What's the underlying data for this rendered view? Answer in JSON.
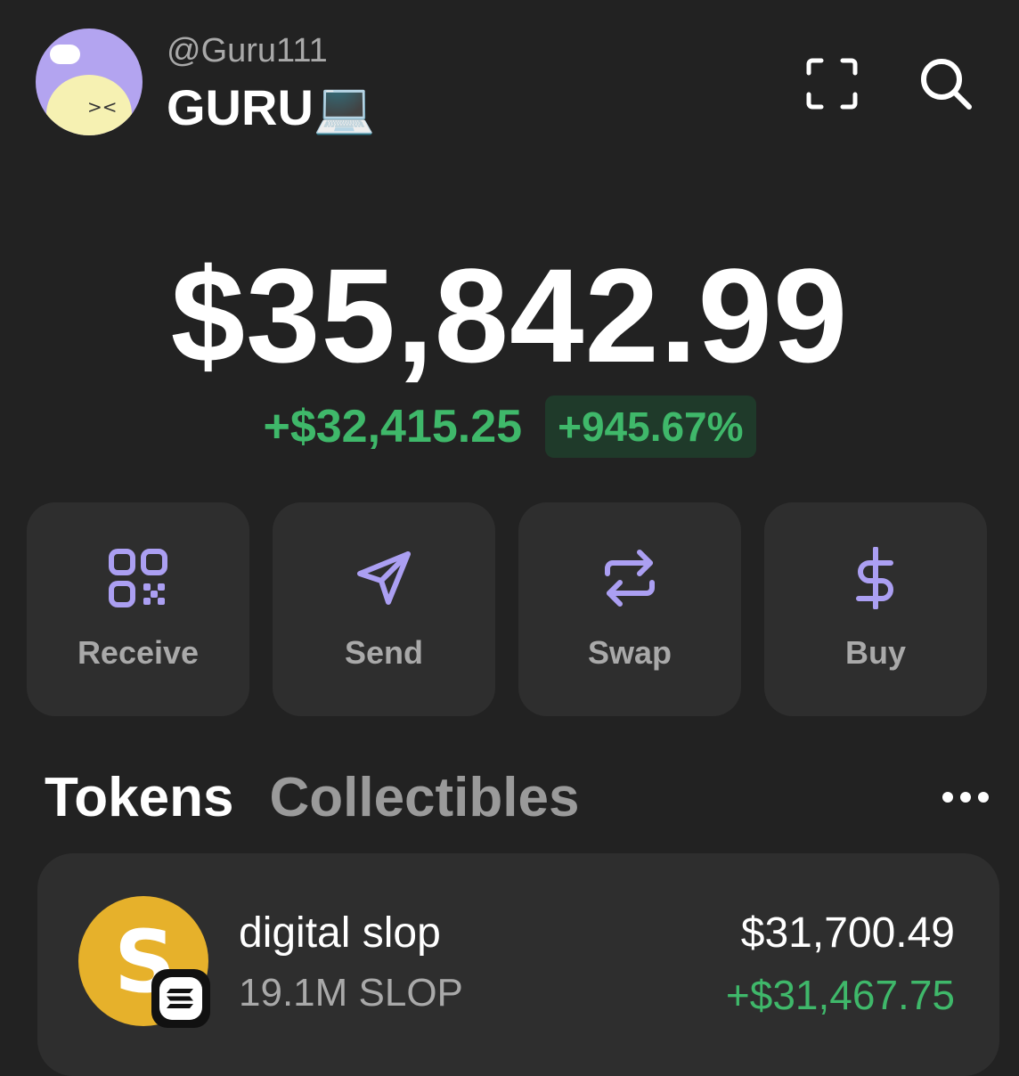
{
  "header": {
    "handle": "@Guru111",
    "username": "GURU💻"
  },
  "portfolio": {
    "balance": "$35,842.99",
    "change_amount": "+$32,415.25",
    "change_percent": "+945.67%"
  },
  "actions": [
    {
      "label": "Receive",
      "icon": "qr-code-icon"
    },
    {
      "label": "Send",
      "icon": "send-icon"
    },
    {
      "label": "Swap",
      "icon": "swap-icon"
    },
    {
      "label": "Buy",
      "icon": "dollar-icon"
    }
  ],
  "tabs": {
    "tokens": "Tokens",
    "collectibles": "Collectibles"
  },
  "tokens": [
    {
      "name": "digital slop",
      "amount": "19.1M SLOP",
      "value": "$31,700.49",
      "change": "+$31,467.75"
    }
  ],
  "colors": {
    "background": "#222222",
    "card": "#2e2e2e",
    "accent": "#ab9ff2",
    "positive": "#3fb86a",
    "positive_bg": "#1f3a2a",
    "muted": "#a9a9a9"
  }
}
